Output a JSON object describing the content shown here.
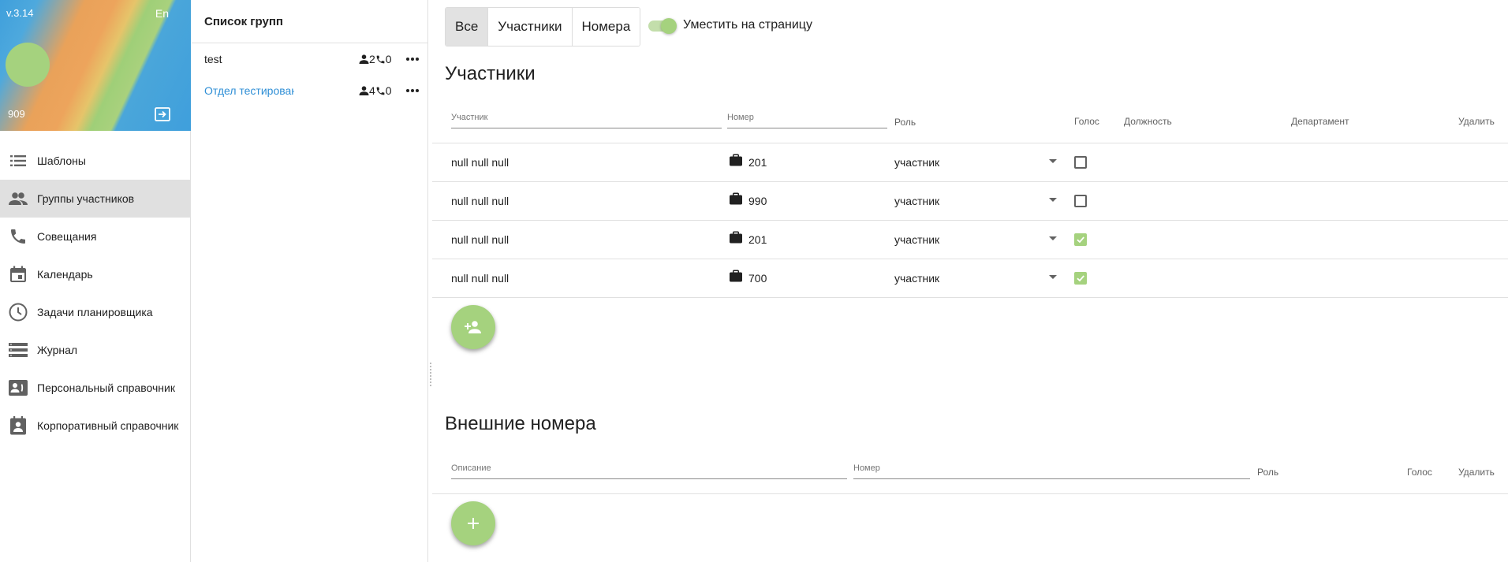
{
  "nav": {
    "version": "v.3.14",
    "language": "En",
    "user_number": "909",
    "menu": [
      {
        "label": "Шаблоны",
        "icon": "list-icon"
      },
      {
        "label": "Группы участников",
        "icon": "people-icon",
        "active": true
      },
      {
        "label": "Совещания",
        "icon": "phone-icon"
      },
      {
        "label": "Календарь",
        "icon": "calendar-icon"
      },
      {
        "label": "Задачи планировщика",
        "icon": "clock-icon"
      },
      {
        "label": "Журнал",
        "icon": "journal-icon"
      },
      {
        "label": "Персональный справочник",
        "icon": "personal-contacts-icon"
      },
      {
        "label": "Корпоративный справочник",
        "icon": "corporate-contacts-icon"
      }
    ]
  },
  "groups": {
    "title": "Список групп",
    "items": [
      {
        "name": "test",
        "members": "2",
        "calls": "0"
      },
      {
        "name": "Отдел тестирования",
        "members": "4",
        "calls": "0",
        "selected": true
      }
    ]
  },
  "main": {
    "tabs": [
      "Все",
      "Участники",
      "Номера"
    ],
    "active_tab": "Все",
    "fit_label": "Уместить на страницу",
    "fit_enabled": true,
    "participants": {
      "title": "Участники",
      "filter_participant_placeholder": "Участник",
      "filter_number_placeholder": "Номер",
      "columns": {
        "role": "Роль",
        "voice": "Голос",
        "position": "Должность",
        "department": "Департамент",
        "delete": "Удалить"
      },
      "rows": [
        {
          "name": "null null null",
          "number": "201",
          "role": "участник",
          "voice": false
        },
        {
          "name": "null null null",
          "number": "990",
          "role": "участник",
          "voice": false
        },
        {
          "name": "null null null",
          "number": "201",
          "role": "участник",
          "voice": true
        },
        {
          "name": "null null null",
          "number": "700",
          "role": "участник",
          "voice": true
        }
      ]
    },
    "external": {
      "title": "Внешние номера",
      "filter_description_placeholder": "Описание",
      "filter_number_placeholder": "Номер",
      "columns": {
        "role": "Роль",
        "voice": "Голос",
        "delete": "Удалить"
      }
    }
  },
  "colors": {
    "accent": "#a5d27e",
    "link": "#2f8fd6",
    "active_bg": "#e0e0e0"
  }
}
